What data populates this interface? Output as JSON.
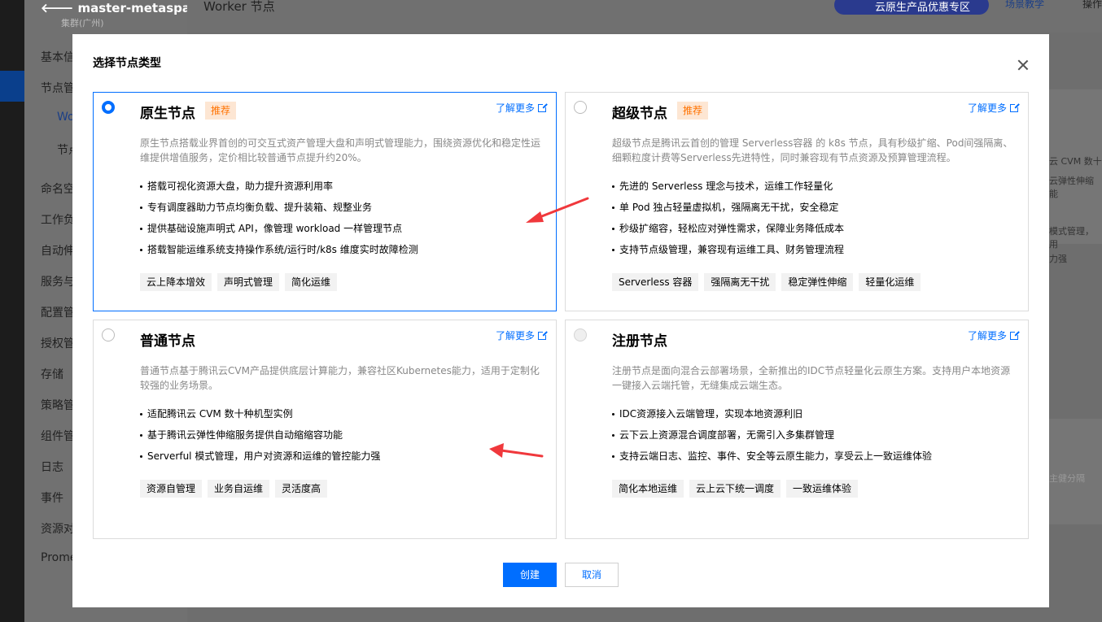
{
  "background": {
    "cluster_name": "master-metaspac...",
    "cluster_region": "集群(广州)",
    "page_title": "Worker 节点",
    "promo_label": "云原生产品优惠专区",
    "scene_teaching": "场景教学",
    "operate": "操作",
    "nav_items": [
      "基本信",
      "节点管",
      "Wo",
      "节点",
      "命名空",
      "工作负",
      "自动伸",
      "服务与",
      "配置管",
      "授权管",
      "存储",
      "策略管",
      "组件管",
      "日志",
      "事件",
      "资源对",
      "Prome"
    ],
    "right_text_1": "云 CVM 数十",
    "right_text_2": "云弹性伸缩能",
    "right_text_3": "模式管理，用",
    "right_text_4": "力强",
    "right_text_5": "主健分隔"
  },
  "modal": {
    "title": "选择节点类型",
    "create_label": "创建",
    "cancel_label": "取消",
    "learn_more": "了解更多",
    "cards": [
      {
        "title": "原生节点",
        "badge": "推荐",
        "selected": true,
        "desc": "原生节点搭载业界首创的可交互式资产管理大盘和声明式管理能力，围绕资源优化和稳定性运维提供增值服务，定价相比较普通节点提升约20%。",
        "features": [
          "搭载可视化资源大盘，助力提升资源利用率",
          "专有调度器助力节点均衡负载、提升装箱、规整业务",
          "提供基础设施声明式 API，像管理 workload 一样管理节点",
          "搭载智能运维系统支持操作系统/运行时/k8s 维度实时故障检测"
        ],
        "tags": [
          "云上降本增效",
          "声明式管理",
          "简化运维"
        ]
      },
      {
        "title": "超级节点",
        "badge": "推荐",
        "selected": false,
        "desc": "超级节点是腾讯云首创的管理 Serverless容器 的 k8s 节点，具有秒级扩缩、Pod间强隔离、细颗粒度计费等Serverless先进特性，同时兼容现有节点资源及预算管理流程。",
        "features": [
          "先进的 Serverless 理念与技术，运维工作轻量化",
          "单 Pod 独占轻量虚拟机，强隔离无干扰，安全稳定",
          "秒级扩缩容，轻松应对弹性需求，保障业务降低成本",
          "支持节点级管理，兼容现有运维工具、财务管理流程"
        ],
        "tags": [
          "Serverless 容器",
          "强隔离无干扰",
          "稳定弹性伸缩",
          "轻量化运维"
        ]
      },
      {
        "title": "普通节点",
        "badge": "",
        "selected": false,
        "desc": "普通节点基于腾讯云CVM产品提供底层计算能力，兼容社区Kubernetes能力，适用于定制化较强的业务场景。",
        "features": [
          "适配腾讯云 CVM 数十种机型实例",
          "基于腾讯云弹性伸缩服务提供自动缩缩容功能",
          "Serverful 模式管理，用户对资源和运维的管控能力强"
        ],
        "tags": [
          "资源自管理",
          "业务自运维",
          "灵活度高"
        ]
      },
      {
        "title": "注册节点",
        "badge": "",
        "selected": false,
        "desc": "注册节点是面向混合云部署场景，全新推出的IDC节点轻量化云原生方案。支持用户本地资源一键接入云端托管，无缝集成云端生态。",
        "features": [
          "IDC资源接入云端管理，实现本地资源利旧",
          "云下云上资源混合调度部署，无需引入多集群管理",
          "支持云端日志、监控、事件、安全等云原生能力，享受云上一致运维体验"
        ],
        "tags": [
          "简化本地运维",
          "云上云下统一调度",
          "一致运维体验"
        ]
      }
    ]
  },
  "colors": {
    "primary": "#006eff",
    "badge_text": "#ff7200",
    "badge_bg": "#fde6d3",
    "annotation_arrow": "#f0383c"
  }
}
